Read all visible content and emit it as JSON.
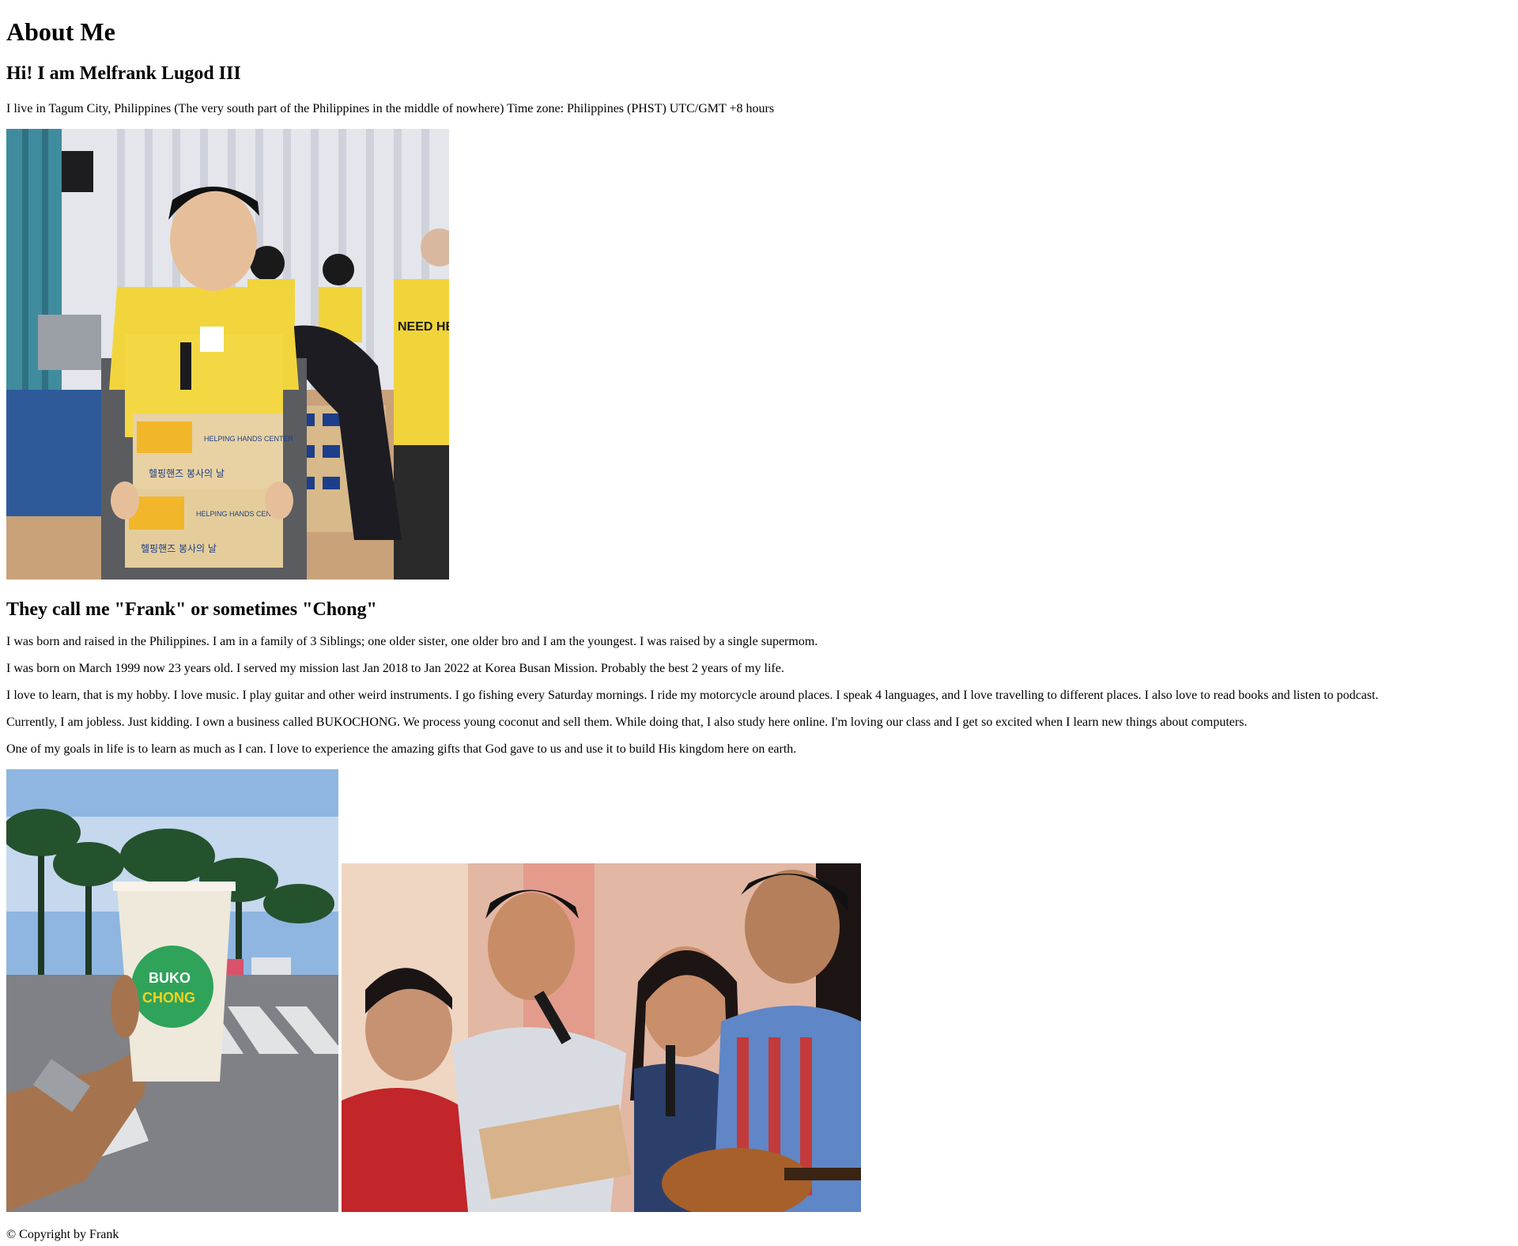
{
  "title": "About Me",
  "greeting": "Hi! I am Melfrank Lugod III",
  "intro": "I live in Tagum City, Philippines (The very south part of the Philippines in the middle of nowhere) Time zone: Philippines (PHST) UTC/GMT +8 hours",
  "nickname_heading": "They call me \"Frank\" or sometimes \"Chong\"",
  "bio": [
    "I was born and raised in the Philippines. I am in a family of 3 Siblings; one older sister, one older bro and I am the youngest. I was raised by a single supermom.",
    "I was born on March 1999 now 23 years old. I served my mission last Jan 2018 to Jan 2022 at Korea Busan Mission. Probably the best 2 years of my life.",
    "I love to learn, that is my hobby. I love music. I play guitar and other weird instruments. I go fishing every Saturday mornings. I ride my motorcycle around places. I speak 4 languages, and I love travelling to different places. I also love to read books and listen to podcast.",
    "Currently, I am jobless. Just kidding. I own a business called BUKOCHONG. We process young coconut and sell them. While doing that, I also study here online. I'm loving our class and I get so excited when I learn new things about computers.",
    "One of my goals in life is to learn as much as I can. I love to experience the amazing gifts that God gave to us and use it to build His kingdom here on earth."
  ],
  "photos": {
    "volunteer": {
      "box_brand": "HELPING HANDS CENTER",
      "box_korean": "헬핑핸즈 봉사의 날",
      "vest_text": "NEED HELP"
    },
    "drink": {
      "logo_line1": "BUKO",
      "logo_line2": "CHONG"
    }
  },
  "footer": "© Copyright by Frank"
}
